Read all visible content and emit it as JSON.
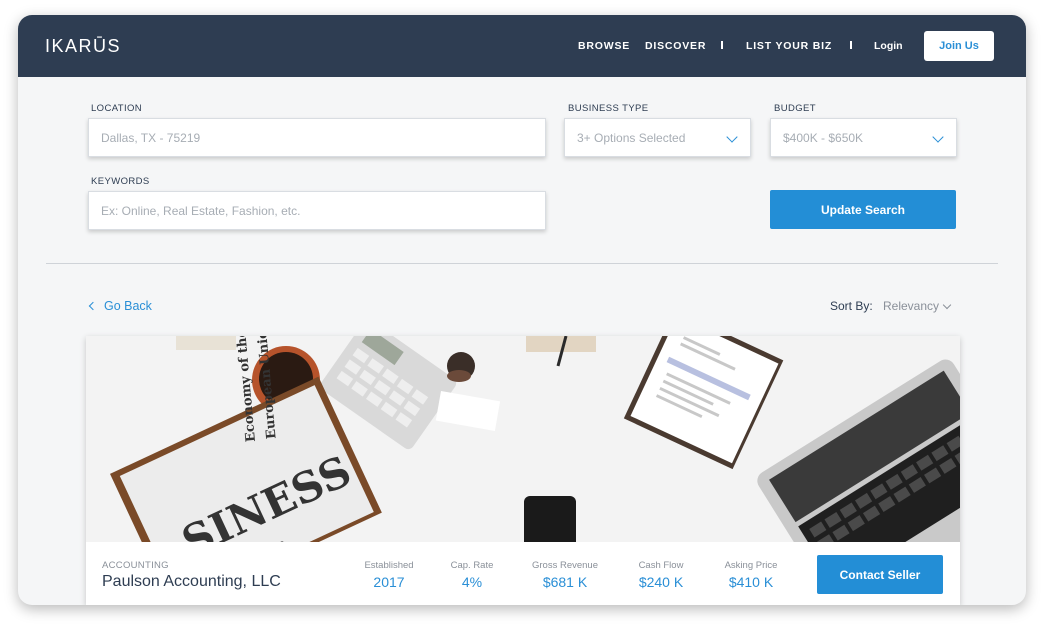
{
  "header": {
    "logo": "IKARŪS",
    "nav": [
      "BROWSE",
      "DISCOVER",
      "LIST YOUR BIZ"
    ],
    "login_label": "Login",
    "join_label": "Join Us"
  },
  "search": {
    "location": {
      "label": "LOCATION",
      "placeholder": "Dallas, TX - 75219"
    },
    "business_type": {
      "label": "BUSINESS TYPE",
      "value": "3+ Options Selected"
    },
    "budget": {
      "label": "BUDGET",
      "value": "$400K - $650K"
    },
    "keywords": {
      "label": "KEYWORDS",
      "placeholder": "Ex: Online, Real Estate, Fashion, etc."
    },
    "update_label": "Update Search"
  },
  "results": {
    "back_label": "Go Back",
    "sort_label": "Sort By:",
    "sort_value": "Relevancy"
  },
  "listing": {
    "photo_text": {
      "newspaper_big": "SINESS",
      "newspaper_headline_1": "Economy of the",
      "newspaper_headline_2": "European Union",
      "newspaper_small": "the"
    },
    "category": "ACCOUNTING",
    "name": "Paulson Accounting, LLC",
    "stats": [
      {
        "label": "Established",
        "value": "2017"
      },
      {
        "label": "Cap. Rate",
        "value": "4%"
      },
      {
        "label": "Gross Revenue",
        "value": "$681 K"
      },
      {
        "label": "Cash Flow",
        "value": "$240 K"
      },
      {
        "label": "Asking Price",
        "value": "$410 K"
      }
    ],
    "contact_label": "Contact Seller"
  },
  "colors": {
    "navy": "#2e3d52",
    "accent": "#238ed6",
    "background": "#f5f6f7"
  }
}
